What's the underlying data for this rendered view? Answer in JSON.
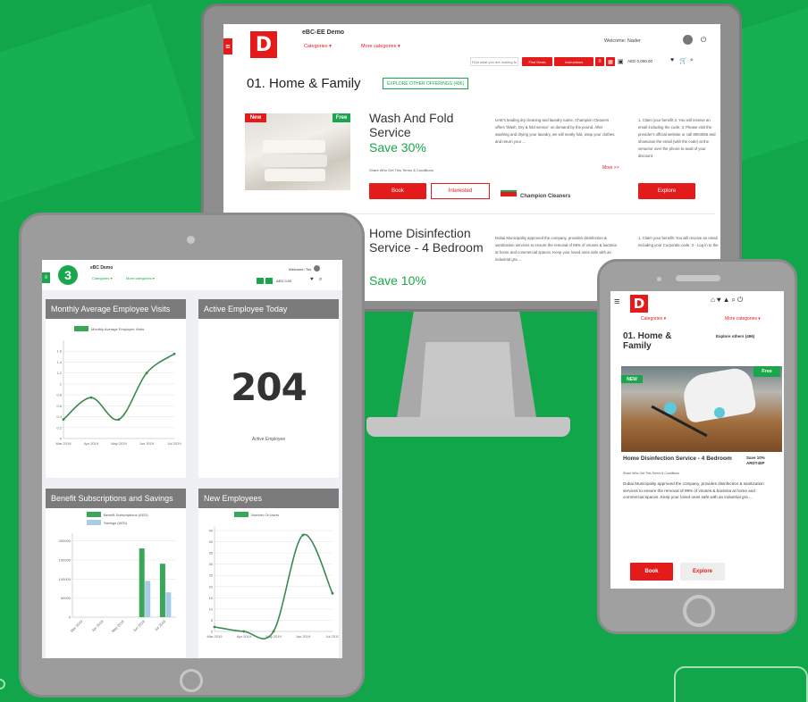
{
  "monitor": {
    "app_title": "eBC-EE Demo",
    "categories_label": "Categories ▾",
    "more_categories_label": "More categories ▾",
    "search_placeholder": "Find what you are looking for",
    "btn_find_deals": "Find Deals",
    "btn_instructions": "Instructions",
    "wallet": "AED 0.000.00",
    "welcome": "Welcome: Nader",
    "page_title": "01. Home & Family",
    "explore_btn": "EXPLORE OTHER OFFERINGS (496)",
    "offer1": {
      "badge_new": "New",
      "badge_free": "Free",
      "title": "Wash And Fold Service",
      "save": "Save 30%",
      "meta": "Share   Who Get This   Terms & Conditions",
      "desc": "UAE's leading dry cleaning and laundry name, Champion Cleaners offers 'Wash, Dry & fold service' on demand by the pound. After washing and drying your laundry, we will neatly fold, wrap your clothes, and return your ...",
      "more": "More >>",
      "book": "Book",
      "interested": "Interested",
      "provider": "Champion Cleaners",
      "how": "1. Claim your benefit 2. You will receive an email including the code. 3. Please visit the provider's official website or call 8004556 and showcase the email (with the code) at the venue/or over the phone to avail of your discount.",
      "explore": "Explore"
    },
    "offer2": {
      "title": "Home Disinfection Service - 4 Bedroom",
      "save": "Save 10%",
      "desc": "Dubai Municipality approved the company, provides disinfection & sanitization services to ensure the removal of 99% of viruses & bacteria at home and commercial spaces. Keep your loved ones safe with an industrial gra ...",
      "how": "1. Claim your benefit! You will receive an email including your Corporate code. 2 - Log in to the"
    }
  },
  "tablet": {
    "app_title": "eBC Demo",
    "categories_label": "Categories ▾",
    "more_categories_label": "More categories ▾",
    "welcome": "Welcome: Tes",
    "wallet": "AED 0.00",
    "panels": {
      "visits_title": "Monthly Average Employee Visits",
      "active_title": "Active Employee Today",
      "active_value": "204",
      "active_label": "Active Employee",
      "benefit_title": "Benefit Subscriptions and Savings",
      "new_title": "New Employees"
    }
  },
  "phone": {
    "categories_label": "Categories ▾",
    "more_categories_label": "More categories ▾",
    "page_title": "01. Home & Family",
    "explore_link": "Explore others (496)",
    "badge_new": "NEW",
    "badge_free": "Free",
    "offer_title": "Home Disinfection Service - 4 Bedroom",
    "save_label": "Save 10% ARDT40P",
    "meta": "Share   Who Get This   Terms & Conditions",
    "desc": "Dubai Municipality approved the company, provides disinfection & sanitization services to ensure the removal of 99% of viruses & bacteria at home and commercial spaces. Keep your loved ones safe with an industrial gra ...",
    "book": "Book",
    "explore": "Explore"
  },
  "colors": {
    "background": "#12a64a",
    "brand_red": "#e41b1b",
    "accent_green": "#1aa64a",
    "panel_header": "#7b7b7b"
  },
  "chart_data": [
    {
      "type": "line",
      "title": "Monthly Average Employee Visits",
      "categories": [
        "Mar 2019",
        "Apr 2019",
        "May 2019",
        "Jun 2019",
        "Jul 2019"
      ],
      "series": [
        {
          "name": "Monthly Average Employee Visits",
          "values": [
            0.35,
            0.75,
            0.35,
            1.2,
            1.55
          ]
        }
      ],
      "yticks": [
        "0",
        "0.2",
        "0.4",
        "0.6",
        "0.8",
        "1",
        "1.2",
        "1.4",
        "1.6"
      ],
      "ylim": [
        0,
        1.8
      ],
      "grid": true,
      "legend": "top"
    },
    {
      "type": "bar",
      "title": "Benefit Subscriptions and Savings",
      "categories": [
        "Mar 2019",
        "Apr 2019",
        "May 2019",
        "Jun 2019",
        "Jul 2019"
      ],
      "series": [
        {
          "name": "Benefit Subscriptions (AED)",
          "values": [
            0,
            0,
            0,
            180000,
            140000
          ]
        },
        {
          "name": "Savings (AED)",
          "values": [
            0,
            0,
            0,
            95000,
            65000
          ]
        }
      ],
      "yticks": [
        "0",
        "50000",
        "100000",
        "150000",
        "200000"
      ],
      "ylim": [
        0,
        220000
      ],
      "grid": true,
      "legend": "top"
    },
    {
      "type": "line",
      "title": "New Employees",
      "categories": [
        "Mar 2019",
        "Apr 2019",
        "May 2019",
        "Jun 2019",
        "Jul 2019"
      ],
      "series": [
        {
          "name": "Number Of Users",
          "values": [
            2,
            0,
            0,
            43,
            17
          ]
        }
      ],
      "yticks": [
        "0",
        "5",
        "10",
        "15",
        "20",
        "25",
        "30",
        "35",
        "40",
        "45"
      ],
      "ylim": [
        0,
        47
      ],
      "grid": true,
      "legend": "top"
    }
  ]
}
